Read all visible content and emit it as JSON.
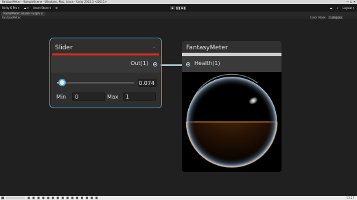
{
  "window": {
    "title": "FantasyMeter - SampleScene - Windows, Mac, Linux - Unity 2022.3 <DX11>",
    "controls": "—  ☐  ✕"
  },
  "toolbar": {
    "account": "Unity 6 Pro ▾",
    "cloud": "☁ ▾",
    "asset_store": "Asset Store ▾",
    "play": "▶",
    "pause": "❚❚",
    "step": "▶❚",
    "layout": "Layout ▾"
  },
  "tabs": {
    "active": "RadialMeter Shader Graph ×"
  },
  "subbar": {
    "breadcrumb": "FantasyMeter",
    "color_mode_label": "Color Mode",
    "color_mode_value": "Category"
  },
  "slider_node": {
    "title": "Slider",
    "output_label": "Out(1)",
    "value": "0.074",
    "value_fraction": 0.074,
    "min_label": "Min",
    "min_value": "0",
    "max_label": "Max",
    "max_value": "1"
  },
  "meter_node": {
    "title": "FantasyMeter",
    "input_label": "Health(1)"
  },
  "statusbar": {
    "clock": "13:27"
  },
  "colors": {
    "accent": "#4ea7c8",
    "slider_bar": "#d0321e",
    "meter_bar": "#cfcfcf",
    "liquid": "#c87a2a"
  },
  "icons": [
    "chevron-down-icon",
    "port-icon",
    "search-icon",
    "gear-icon"
  ]
}
